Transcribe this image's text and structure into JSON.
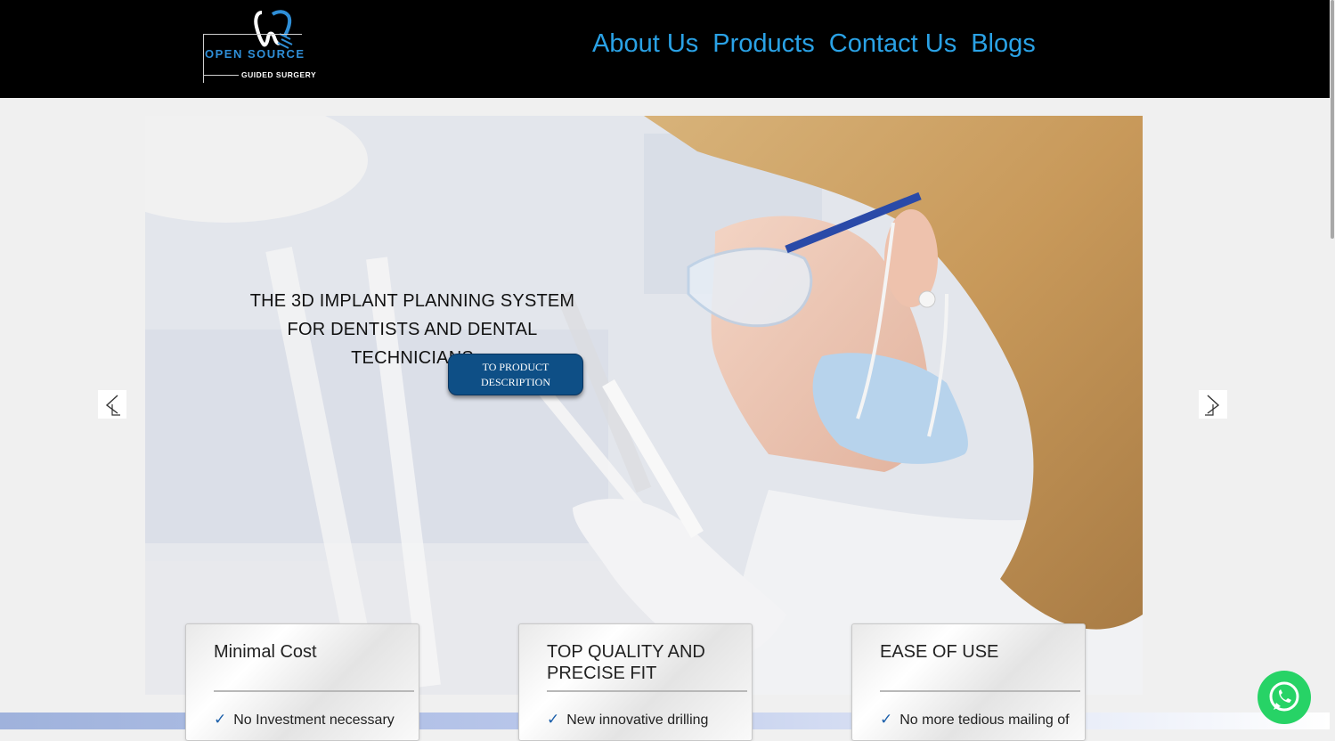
{
  "header": {
    "logo": {
      "line1": "OPEN SOURCE",
      "line2": "GUIDED SURGERY"
    },
    "nav": [
      "About Us",
      "Products",
      "Contact Us",
      "Blogs"
    ]
  },
  "hero": {
    "headline_line1": "THE 3D IMPLANT PLANNING SYSTEM",
    "headline_line2": "FOR DENTISTS AND DENTAL TECHNICIANS",
    "button_line1": "TO PRODUCT",
    "button_line2": "DESCRIPTION",
    "image_description_icon": "dentist-photo",
    "prev_icon": "chevron-left-icon",
    "next_icon": "chevron-right-icon"
  },
  "features": [
    {
      "title": "Minimal Cost",
      "item": "No Investment necessary"
    },
    {
      "title": "TOP QUALITY AND PRECISE FIT",
      "item": "New innovative drilling"
    },
    {
      "title": "EASE OF USE",
      "item": "No more tedious mailing of"
    }
  ],
  "colors": {
    "nav_link": "#2aa2e6",
    "header_bg": "#000000",
    "button_bg": "#0e4f86",
    "check": "#1b5faa",
    "whatsapp": "#27d366"
  }
}
